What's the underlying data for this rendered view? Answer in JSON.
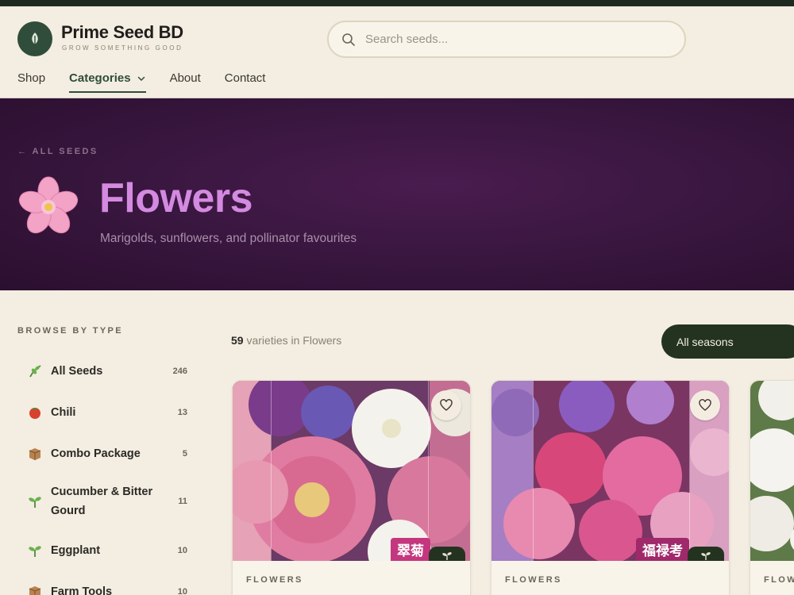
{
  "header": {
    "brand_name": "Prime Seed BD",
    "brand_tagline": "GROW SOMETHING GOOD",
    "search_placeholder": "Search seeds...",
    "nav": [
      {
        "label": "Shop"
      },
      {
        "label": "Categories"
      },
      {
        "label": "About"
      },
      {
        "label": "Contact"
      }
    ],
    "active_nav": "Categories"
  },
  "hero": {
    "back_label": "← ALL SEEDS",
    "icon": "cherry-blossom-icon",
    "title": "Flowers",
    "subtitle": "Marigolds, sunflowers, and pollinator favourites"
  },
  "sidebar": {
    "title": "BROWSE BY TYPE",
    "items": [
      {
        "icon": "herb-icon",
        "label": "All Seeds",
        "count": "246"
      },
      {
        "icon": "tomato-icon",
        "label": "Chili",
        "count": "13"
      },
      {
        "icon": "package-icon",
        "label": "Combo Package",
        "count": "5"
      },
      {
        "icon": "seedling-icon",
        "label": "Cucumber & Bitter Gourd",
        "count": "11"
      },
      {
        "icon": "seedling-icon",
        "label": "Eggplant",
        "count": "10"
      },
      {
        "icon": "package-icon",
        "label": "Farm Tools",
        "count": "10"
      }
    ]
  },
  "results": {
    "count": "59",
    "count_suffix": "varieties",
    "in_text": "in Flowers",
    "season_filter": "All seasons"
  },
  "products": [
    {
      "category": "FLOWERS",
      "package_text": "翠菊",
      "image": "pink-aster-flowers"
    },
    {
      "category": "FLOWERS",
      "package_text": "福禄考",
      "image": "pink-phlox-flowers"
    },
    {
      "category": "FLOW",
      "package_text": "",
      "image": "white-petunia-flowers"
    }
  ],
  "colors": {
    "accent_green": "#2f4d3a",
    "hero_bg": "#3a1740",
    "hero_title": "#d38ae0",
    "page_bg": "#f3ede2"
  }
}
